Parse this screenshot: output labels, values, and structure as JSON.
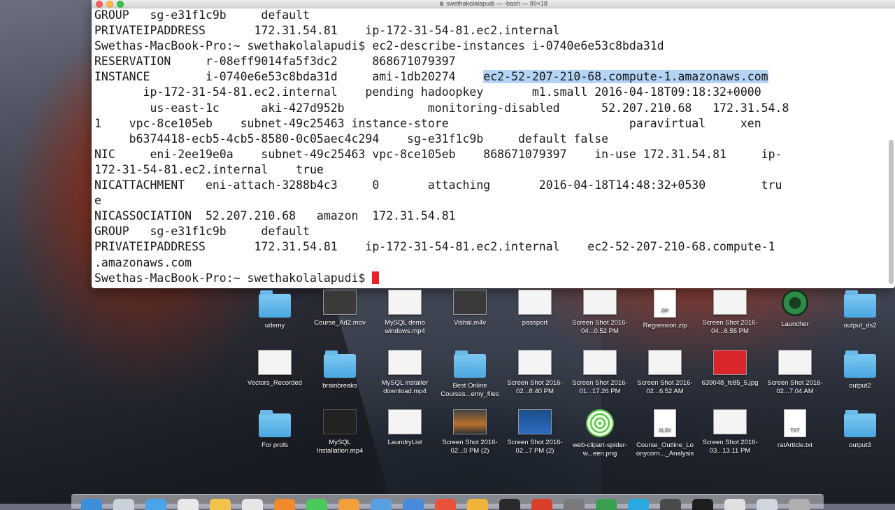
{
  "window": {
    "title": "swethakolalapudi — -bash — 99×18"
  },
  "terminal": {
    "lines": [
      "GROUP   sg-e31f1c9b     default",
      "PRIVATEIPADDRESS       172.31.54.81    ip-172-31-54-81.ec2.internal",
      "Swethas-MacBook-Pro:~ swethakolalapudi$ ec2-describe-instances i-0740e6e53c8bda31d",
      "RESERVATION     r-08eff9014fa5f3dc2     868671079397",
      "__INSTANCE__",
      "       ip-172-31-54-81.ec2.internal    pending hadoopkey       m1.small 2016-04-18T09:18:32+0000",
      "        us-east-1c      aki-427d952b            monitoring-disabled      52.207.210.68   172.31.54.8",
      "1    vpc-8ce105eb    subnet-49c25463 instance-store                          paravirtual     xen",
      "     b6374418-ecb5-4cb5-8580-0c05aec4c294    sg-e31f1c9b     default false",
      "NIC     eni-2ee19e0a    subnet-49c25463 vpc-8ce105eb    868671079397    in-use 172.31.54.81     ip-",
      "172-31-54-81.ec2.internal    true",
      "NICATTACHMENT   eni-attach-3288b4c3     0       attaching       2016-04-18T14:48:32+0530        tru",
      "e",
      "NICASSOCIATION  52.207.210.68   amazon  172.31.54.81",
      "GROUP   sg-e31f1c9b     default",
      "PRIVATEIPADDRESS       172.31.54.81    ip-172-31-54-81.ec2.internal    ec2-52-207-210-68.compute-1",
      ".amazonaws.com"
    ],
    "instance_prefix": "INSTANCE        i-0740e6e53c8bda31d     ami-1db20274    ",
    "instance_selected": "ec2-52-207-210-68.compute-1.amazonaws.com",
    "prompt": "Swethas-MacBook-Pro:~ swethakolalapudi$ "
  },
  "desktop": {
    "row1": [
      {
        "label": "udemy",
        "kind": "folder"
      },
      {
        "label": "Course_Ad2.mov",
        "kind": "thumb-video"
      },
      {
        "label": "MySQL demo windows.mp4",
        "kind": "thumb"
      },
      {
        "label": "Vishal.m4v",
        "kind": "thumb-video"
      },
      {
        "label": "passport",
        "kind": "thumb"
      },
      {
        "label": "Screen Shot 2016-04...0.52 PM",
        "kind": "thumb"
      },
      {
        "label": "Regression.zip",
        "kind": "doc",
        "badge": "ZIP"
      },
      {
        "label": "Screen Shot 2016-04...6.55 PM",
        "kind": "thumb"
      },
      {
        "label": "Launcher",
        "kind": "launcher"
      },
      {
        "label": "output_ds2",
        "kind": "folder"
      }
    ],
    "row2": [
      {
        "label": "Vectors_Recorded",
        "kind": "thumb"
      },
      {
        "label": "brainbreaks",
        "kind": "folder"
      },
      {
        "label": "MySQL installer download.mp4",
        "kind": "thumb"
      },
      {
        "label": "Best Online Courses...emy_files",
        "kind": "folder"
      },
      {
        "label": "Screen Shot 2016-02...8.40 PM",
        "kind": "thumb"
      },
      {
        "label": "Screen Shot 2016-01...17.26 PM",
        "kind": "thumb"
      },
      {
        "label": "Screen Shot 2016-02...6.52 AM",
        "kind": "thumb"
      },
      {
        "label": "639048_fc85_5.jpg",
        "kind": "thumb-red"
      },
      {
        "label": "Screen Shot 2016-02...7.04 AM",
        "kind": "thumb"
      },
      {
        "label": "output2",
        "kind": "folder"
      }
    ],
    "row3": [
      {
        "label": "For profs",
        "kind": "folder"
      },
      {
        "label": "MySQL Installation.mp4",
        "kind": "thumb-dark"
      },
      {
        "label": "LaundryList",
        "kind": "thumb"
      },
      {
        "label": "Screen Shot 2016-02...0 PM (2)",
        "kind": "thumb-photo"
      },
      {
        "label": "Screen Shot 2016-02...7 PM (2)",
        "kind": "thumb-blue"
      },
      {
        "label": "web-clipart-spider-w...een.png",
        "kind": "spider"
      },
      {
        "label": "Course_Outline_Lo onycorn..._Analysis",
        "kind": "doc",
        "badge": "XLSX"
      },
      {
        "label": "Screen Shot 2016-03...13.11 PM",
        "kind": "thumb"
      },
      {
        "label": "ratArticle.txt",
        "kind": "doc",
        "badge": "TXT"
      },
      {
        "label": "output3",
        "kind": "folder"
      }
    ]
  },
  "colors": {
    "selection": "#b4d4f7",
    "cursor": "#e8202a",
    "folder": "#5ab4e8"
  }
}
